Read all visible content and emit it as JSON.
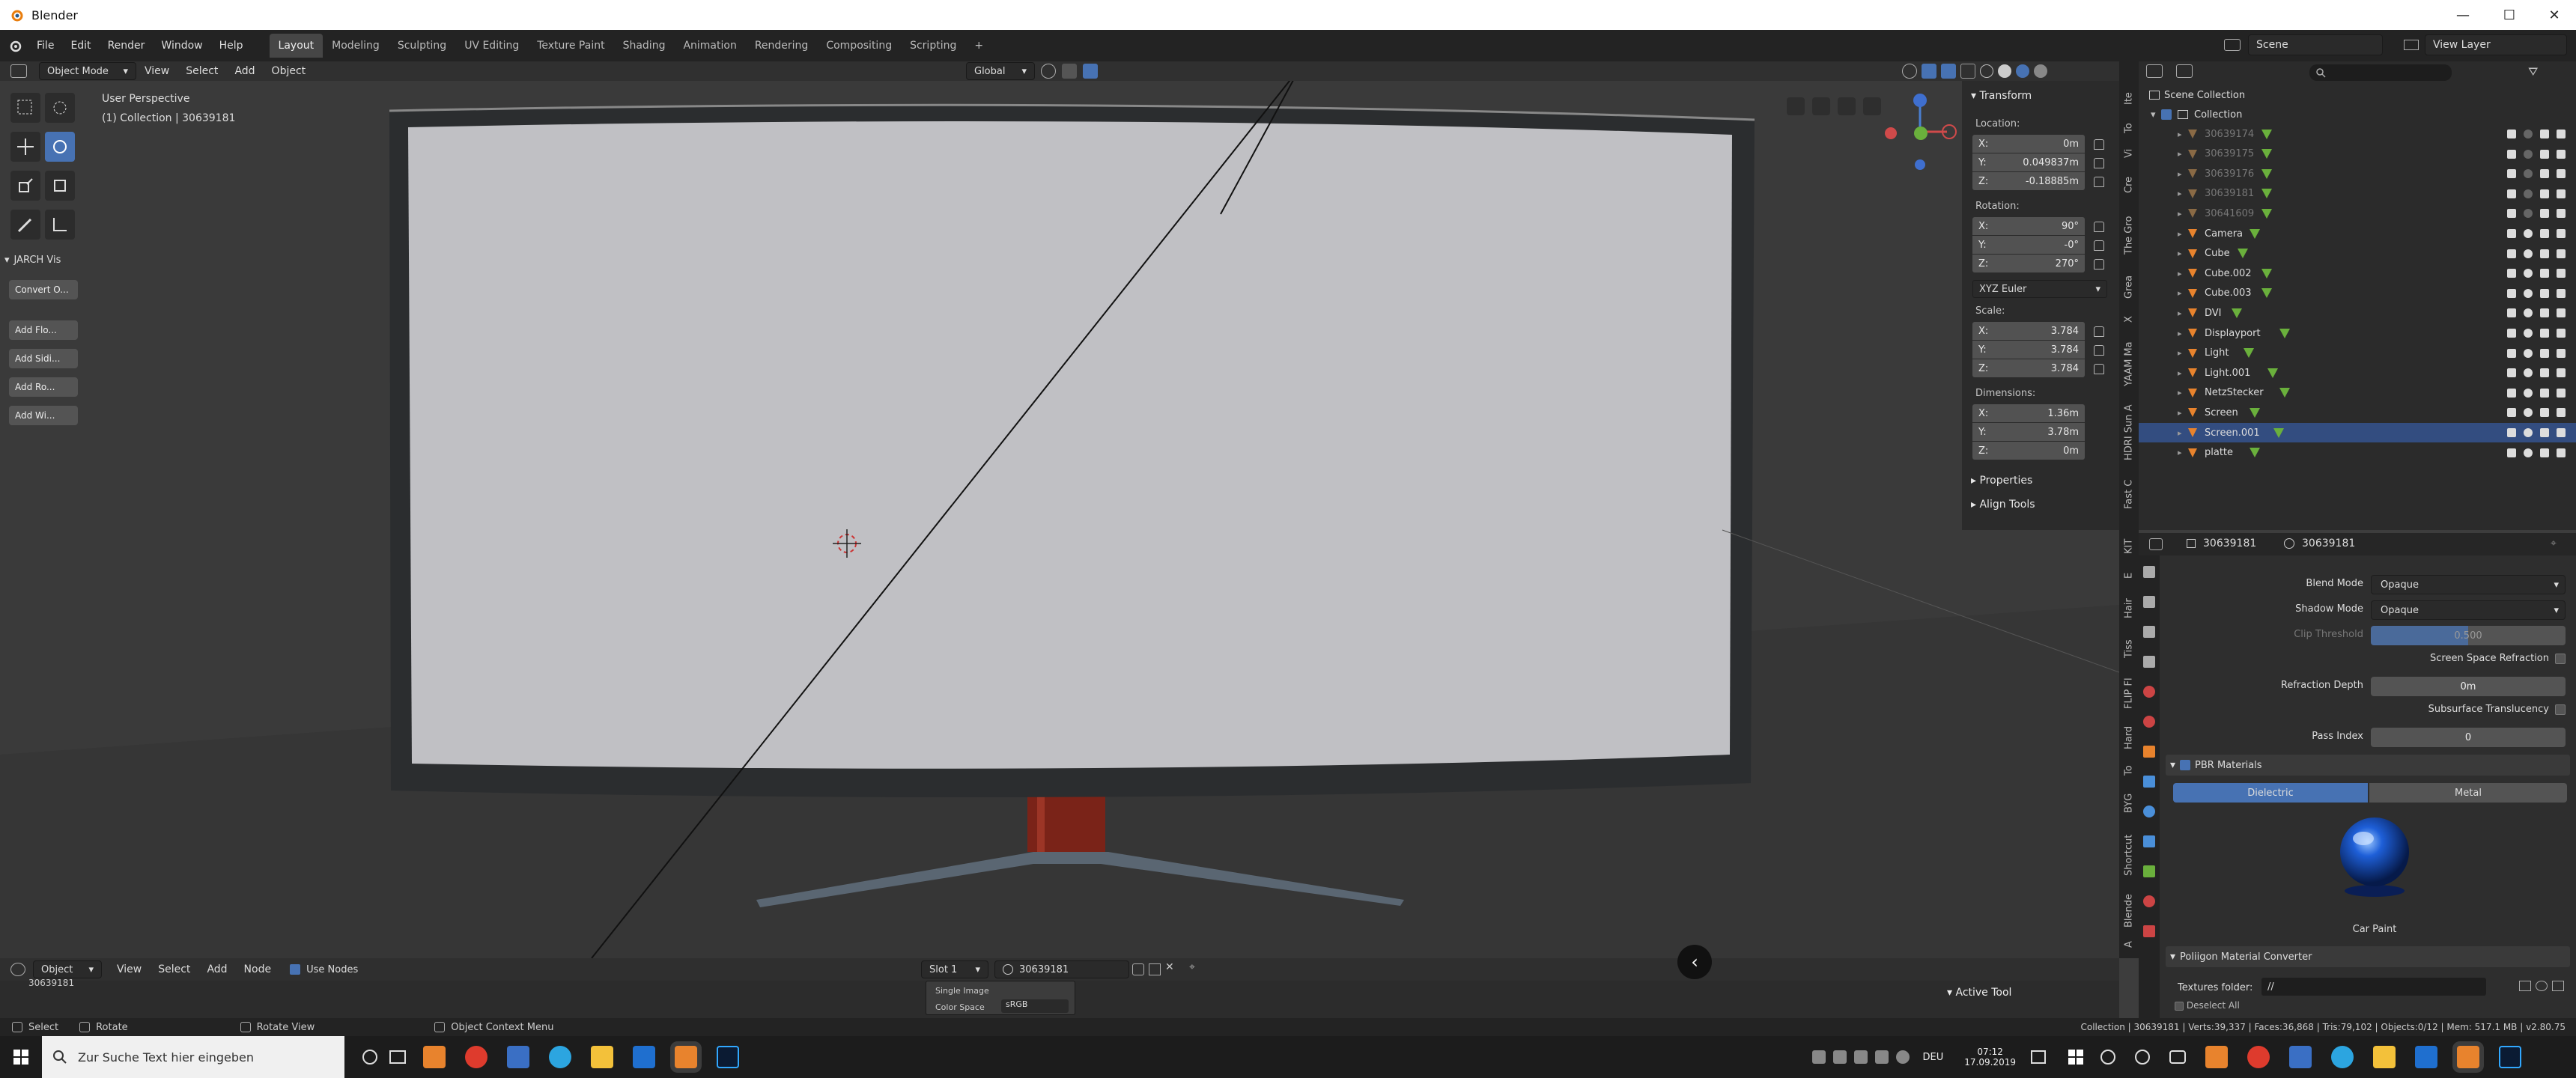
{
  "window": {
    "title": "Blender",
    "minimize": "—",
    "maximize": "☐",
    "close": "✕"
  },
  "menu": [
    "File",
    "Edit",
    "Render",
    "Window",
    "Help"
  ],
  "workspaces": [
    "Layout",
    "Modeling",
    "Sculpting",
    "UV Editing",
    "Texture Paint",
    "Shading",
    "Animation",
    "Rendering",
    "Compositing",
    "Scripting"
  ],
  "workspace_add": "+",
  "scene": {
    "name": "Scene",
    "view_layer": "View Layer"
  },
  "viewport_header": {
    "mode": "Object Mode",
    "items": [
      "View",
      "Select",
      "Add",
      "Object"
    ],
    "transform_orientation": "Global"
  },
  "viewport": {
    "perspective": "User Perspective",
    "collection_info": "(1) Collection | 30639181"
  },
  "tool_panel": {
    "section": "JARCH Vis",
    "convert_button": "Convert O...",
    "buttons": [
      "Add Flo...",
      "Add Sidi...",
      "Add Ro...",
      "Add Wi..."
    ]
  },
  "npanel": {
    "transform_title": "Transform",
    "location_label": "Location:",
    "location": {
      "x": "0m",
      "y": "0.049837m",
      "z": "-0.18885m"
    },
    "rotation_label": "Rotation:",
    "rotation": {
      "x": "90°",
      "y": "-0°",
      "z": "270°"
    },
    "rotation_mode": "XYZ Euler",
    "scale_label": "Scale:",
    "scale": {
      "x": "3.784",
      "y": "3.784",
      "z": "3.784"
    },
    "dimensions_label": "Dimensions:",
    "dimensions": {
      "x": "1.36m",
      "y": "3.78m",
      "z": "0m"
    },
    "axis_x": "X:",
    "axis_y": "Y:",
    "axis_z": "Z:",
    "properties": "Properties",
    "align_tools": "Align Tools"
  },
  "sidebar_tabs": [
    "Ite",
    "To",
    "Vi",
    "Cre",
    "The Gro",
    "Grea",
    "X",
    "YAAM Ma",
    "HDRI Sun A",
    "Fast C",
    "KIT",
    "E",
    "Hair",
    "Tiss",
    "FLIP Fl",
    "Hard",
    "To",
    "BYG",
    "Shortcut",
    "Blende",
    "A"
  ],
  "outliner": {
    "root": "Scene Collection",
    "collection": "Collection",
    "items": [
      {
        "name": "30639174",
        "dim": true
      },
      {
        "name": "30639175",
        "dim": true
      },
      {
        "name": "30639176",
        "dim": true
      },
      {
        "name": "30639181",
        "dim": true
      },
      {
        "name": "30641609",
        "dim": true
      },
      {
        "name": "Camera",
        "dim": false
      },
      {
        "name": "Cube",
        "dim": false
      },
      {
        "name": "Cube.002",
        "dim": false
      },
      {
        "name": "Cube.003",
        "dim": false
      },
      {
        "name": "DVI",
        "dim": false
      },
      {
        "name": "Displayport",
        "dim": false
      },
      {
        "name": "Light",
        "dim": false
      },
      {
        "name": "Light.001",
        "dim": false
      },
      {
        "name": "NetzStecker",
        "dim": false
      },
      {
        "name": "Screen",
        "dim": false
      },
      {
        "name": "Screen.001",
        "dim": false,
        "selected": true
      },
      {
        "name": "platte",
        "dim": false
      }
    ]
  },
  "properties": {
    "object": "30639181",
    "material": "30639181",
    "blend_mode_label": "Blend Mode",
    "blend_mode": "Opaque",
    "shadow_mode_label": "Shadow Mode",
    "shadow_mode": "Opaque",
    "clip_threshold_label": "Clip Threshold",
    "clip_threshold": "0.500",
    "ssr_label": "Screen Space Refraction",
    "refraction_depth_label": "Refraction Depth",
    "refraction_depth": "0m",
    "subsurface_label": "Subsurface Translucency",
    "pass_index_label": "Pass Index",
    "pass_index": "0",
    "pbr_section": "PBR Materials",
    "pbr_tabs": [
      "Dielectric",
      "Metal"
    ],
    "preview_name": "Car Paint",
    "converter_section": "Poliigon Material Converter",
    "textures_label": "Textures folder:",
    "textures_value": "//",
    "deselect_all": "Deselect All"
  },
  "shader_header": {
    "mode": "Object",
    "items": [
      "View",
      "Select",
      "Add",
      "Node"
    ],
    "use_nodes": "Use Nodes",
    "slot": "Slot 1",
    "material": "30639181"
  },
  "node_area": {
    "label_a": "30639181",
    "single_image": "Single Image",
    "color_space_label": "Color Space",
    "color_space": "sRGB",
    "active_tool": "Active Tool"
  },
  "statusbar": {
    "select": "Select",
    "rotate": "Rotate",
    "rotate_view": "Rotate View",
    "context_menu": "Object Context Menu",
    "stats": "Collection | 30639181 | Verts:39,337 | Faces:36,868 | Tris:79,102 | Objects:0/12 | Mem: 517.1 MB | v2.80.75"
  },
  "taskbar": {
    "search_placeholder": "Zur Suche Text hier eingeben",
    "lang": "DEU",
    "time": "07:12",
    "date": "17.09.2019"
  },
  "colors": {
    "accent": "#4772b3",
    "selected_row": "#334d80",
    "header": "#232323",
    "panel": "#2b2b2b"
  }
}
